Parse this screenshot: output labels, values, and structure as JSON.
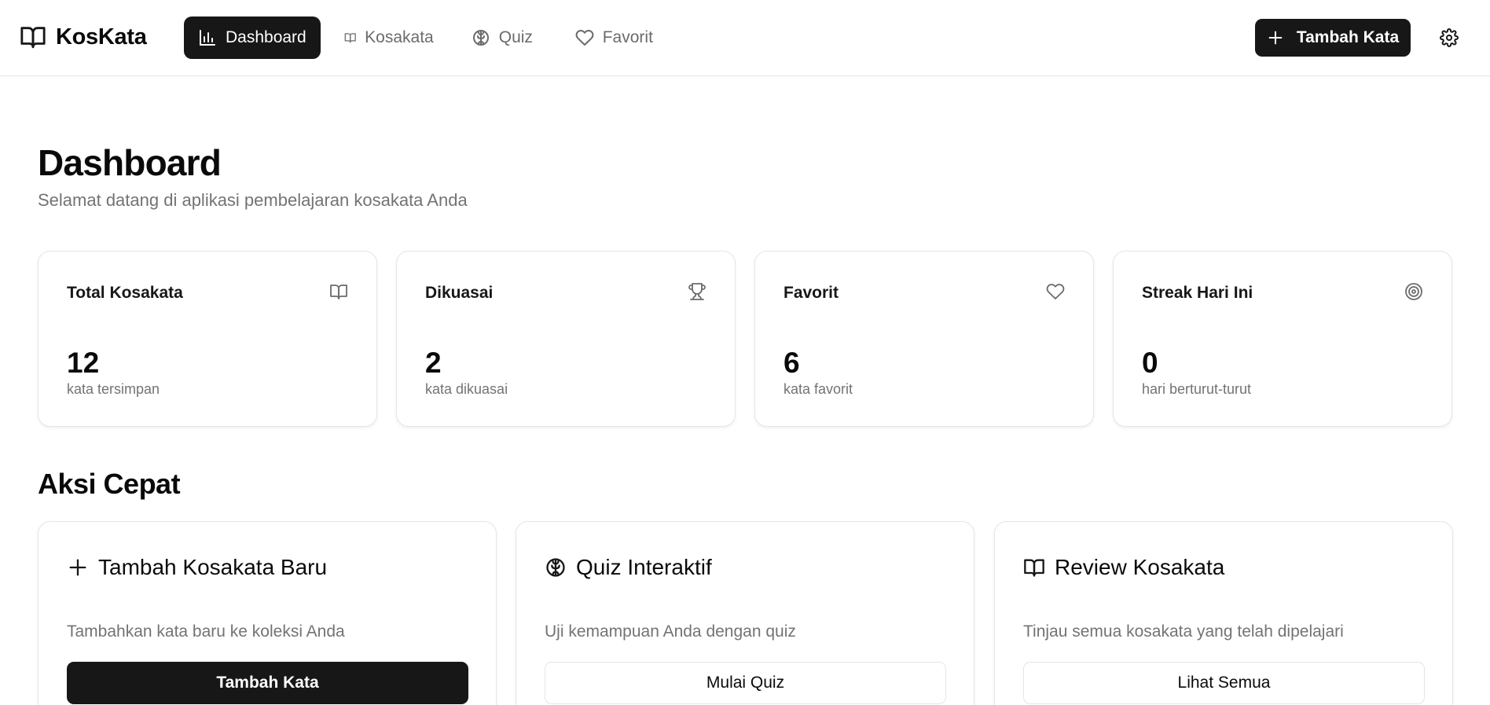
{
  "brand": {
    "name": "KosKata",
    "icon": "book-open-icon"
  },
  "nav": {
    "items": [
      {
        "label": "Dashboard",
        "icon": "bar-chart-icon",
        "active": true
      },
      {
        "label": "Kosakata",
        "icon": "book-open-icon",
        "active": false
      },
      {
        "label": "Quiz",
        "icon": "brain-icon",
        "active": false
      },
      {
        "label": "Favorit",
        "icon": "heart-icon",
        "active": false
      }
    ]
  },
  "header_actions": {
    "add_label": "Tambah Kata",
    "settings_icon": "gear-icon"
  },
  "page": {
    "title": "Dashboard",
    "subtitle": "Selamat datang di aplikasi pembelajaran kosakata Anda"
  },
  "stats": [
    {
      "title": "Total Kosakata",
      "value": "12",
      "caption": "kata tersimpan",
      "icon": "book-open-icon"
    },
    {
      "title": "Dikuasai",
      "value": "2",
      "caption": "kata dikuasai",
      "icon": "trophy-icon"
    },
    {
      "title": "Favorit",
      "value": "6",
      "caption": "kata favorit",
      "icon": "heart-icon"
    },
    {
      "title": "Streak Hari Ini",
      "value": "0",
      "caption": "hari berturut-turut",
      "icon": "target-icon"
    }
  ],
  "quick_actions": {
    "title": "Aksi Cepat",
    "cards": [
      {
        "title": "Tambah Kosakata Baru",
        "desc": "Tambahkan kata baru ke koleksi Anda",
        "button": "Tambah Kata",
        "icon": "plus-icon"
      },
      {
        "title": "Quiz Interaktif",
        "desc": "Uji kemampuan Anda dengan quiz",
        "button": "Mulai Quiz",
        "icon": "brain-icon"
      },
      {
        "title": "Review Kosakata",
        "desc": "Tinjau semua kosakata yang telah dipelajari",
        "button": "Lihat Semua",
        "icon": "book-open-icon"
      }
    ]
  },
  "colors": {
    "primary": "#171717",
    "muted": "#737373",
    "border": "#e5e5e5"
  }
}
